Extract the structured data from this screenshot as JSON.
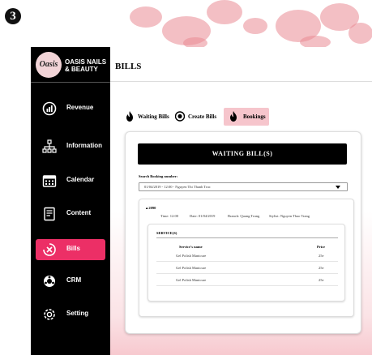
{
  "step_number": "3",
  "brand": {
    "logo_text": "Oasis",
    "name": "OASIS NAILS & BEAUTY"
  },
  "sidebar": {
    "items": [
      {
        "label": "Revenue",
        "icon": "revenue-icon"
      },
      {
        "label": "Information",
        "icon": "information-icon"
      },
      {
        "label": "Calendar",
        "icon": "calendar-icon"
      },
      {
        "label": "Content",
        "icon": "content-icon"
      },
      {
        "label": "Bills",
        "icon": "bills-icon",
        "active": true
      },
      {
        "label": "CRM",
        "icon": "crm-icon"
      },
      {
        "label": "Setting",
        "icon": "setting-icon"
      }
    ]
  },
  "page": {
    "title": "BILLS"
  },
  "tabs": [
    {
      "label": "Waiting Bills",
      "icon": "fire-icon"
    },
    {
      "label": "Create Bills",
      "icon": "create-icon"
    },
    {
      "label": "Bookings",
      "icon": "fire-icon",
      "active": true
    }
  ],
  "waiting": {
    "header": "WAITING BILL(S)",
    "search_label": "Search Booking number:",
    "search_value": "01/04/2019 - 12:00 - Nguyen Thi Thanh Truc"
  },
  "bill": {
    "number": "2090",
    "time": "Time: 12:00",
    "date": "Date: 01/04/2019",
    "branch": "Branch: Quang Trung",
    "stylist": "Stylist: Nguyen Thao Trang",
    "services_title": "SERVICE(S)",
    "col_name": "Service's name",
    "col_price": "Price",
    "rows": [
      {
        "name": "Gel Polish Manicure",
        "price": "25e"
      },
      {
        "name": "Gel Polish Manicure",
        "price": "25e"
      },
      {
        "name": "Gel Polish Manicure",
        "price": "25e"
      }
    ]
  },
  "colors": {
    "accent": "#ec2f66",
    "sidebar_bg": "#000000",
    "tab_active": "#f6c5cc"
  }
}
